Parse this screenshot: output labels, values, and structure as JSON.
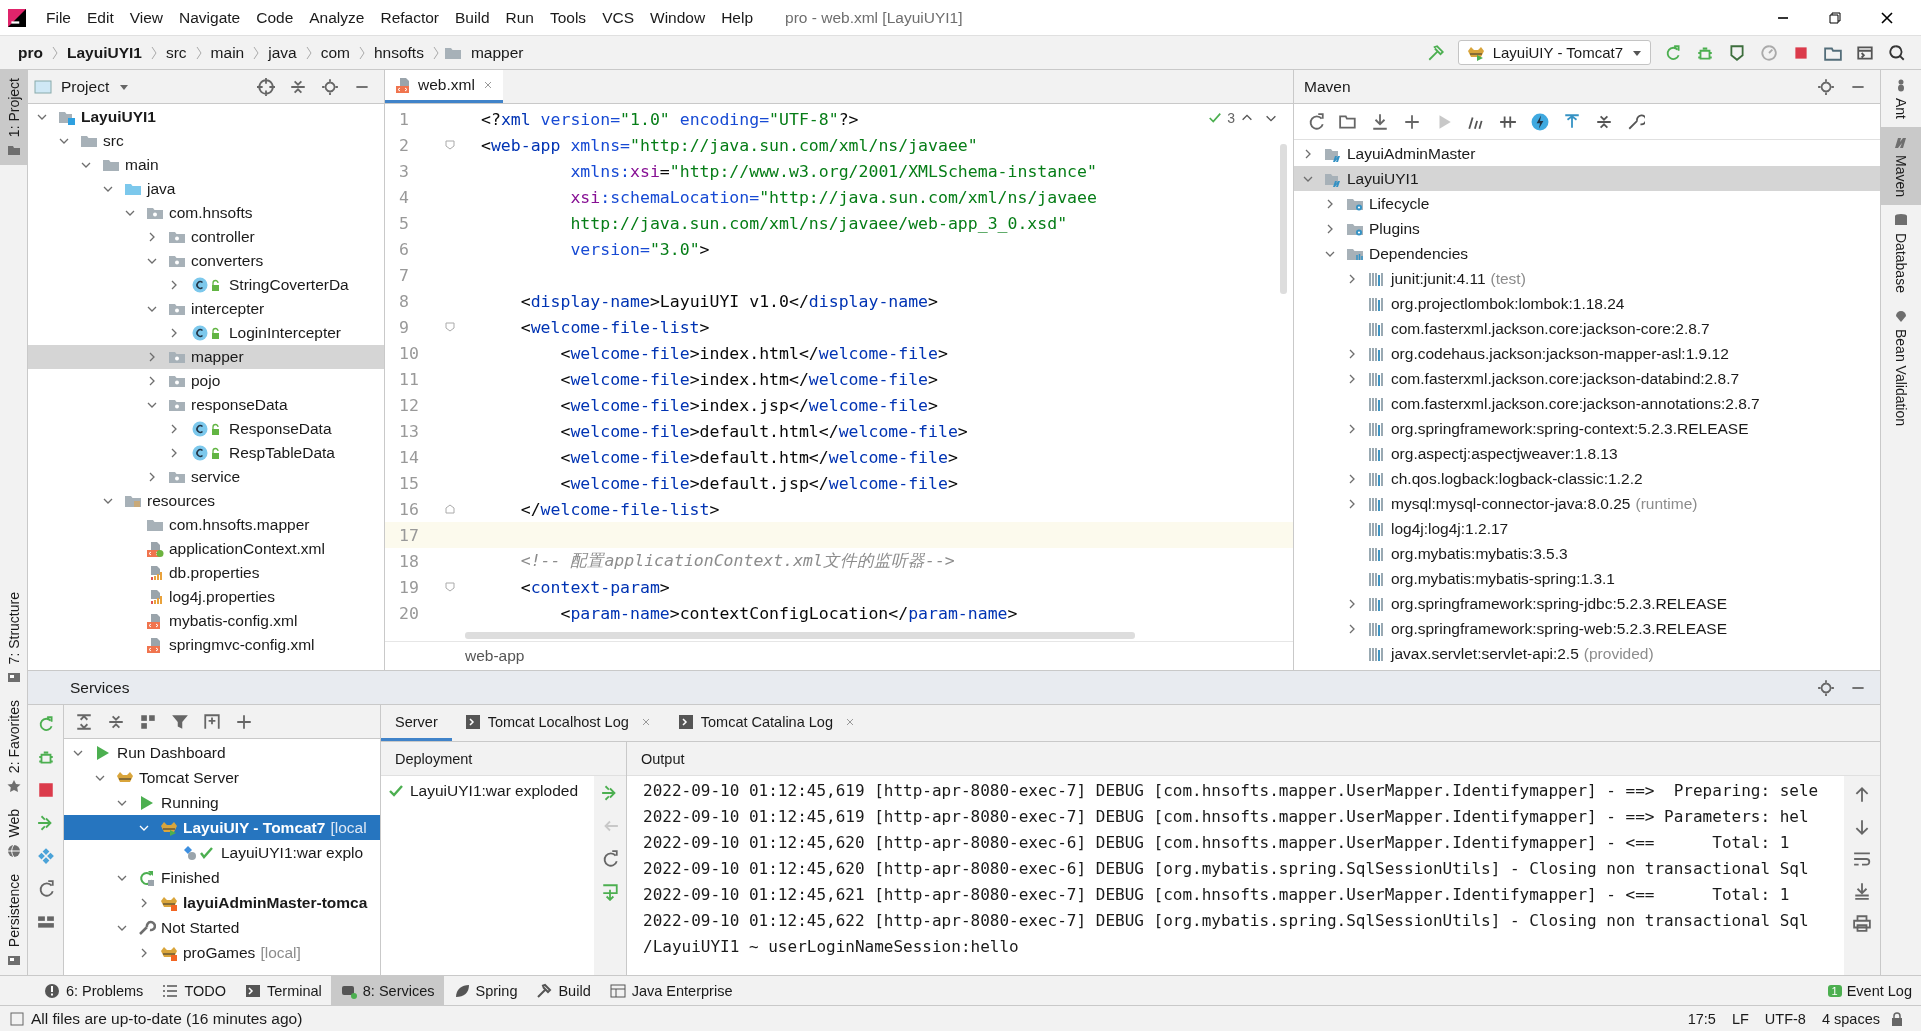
{
  "window": {
    "title": "pro - web.xml [LayuiUYI1]"
  },
  "menu": [
    "File",
    "Edit",
    "View",
    "Navigate",
    "Code",
    "Analyze",
    "Refactor",
    "Build",
    "Run",
    "Tools",
    "VCS",
    "Window",
    "Help"
  ],
  "breadcrumbs": [
    {
      "label": "pro",
      "bold": true
    },
    {
      "label": "LayuiUYI1",
      "bold": true
    },
    {
      "label": "src",
      "bold": false
    },
    {
      "label": "main",
      "bold": false
    },
    {
      "label": "java",
      "bold": false
    },
    {
      "label": "com",
      "bold": false
    },
    {
      "label": "hnsofts",
      "bold": false
    },
    {
      "label": "mapper",
      "bold": false,
      "kind": "folder"
    }
  ],
  "run_config": {
    "label": "LayuiUIY - Tomcat7"
  },
  "left_strip": [
    {
      "label": "1: Project",
      "kind": "folder",
      "selected": true
    },
    {
      "label": "7: Structure",
      "kind": "structure",
      "selected": false
    },
    {
      "label": "2: Favorites",
      "kind": "star",
      "selected": false
    },
    {
      "label": "Web",
      "kind": "globe",
      "selected": false
    },
    {
      "label": "Persistence",
      "kind": "persistence",
      "selected": false
    }
  ],
  "right_strip": [
    {
      "label": "Ant",
      "kind": "ant",
      "selected": false
    },
    {
      "label": "Maven",
      "kind": "maven",
      "selected": true
    },
    {
      "label": "Database",
      "kind": "database",
      "selected": false
    },
    {
      "label": "Bean Validation",
      "kind": "bean",
      "selected": false
    }
  ],
  "project": {
    "title": "Project",
    "tree": [
      {
        "label": "LayuiUYI1",
        "kind": "module",
        "bold": true,
        "expanded": true,
        "selected": false,
        "children": [
          {
            "label": "src",
            "kind": "folder",
            "expanded": true,
            "selected": false,
            "children": [
              {
                "label": "main",
                "kind": "folder",
                "expanded": true,
                "selected": false,
                "children": [
                  {
                    "label": "java",
                    "kind": "src-folder",
                    "expanded": true,
                    "selected": false,
                    "children": [
                      {
                        "label": "com.hnsofts",
                        "kind": "package",
                        "expanded": true,
                        "selected": false,
                        "children": [
                          {
                            "label": "controller",
                            "kind": "package",
                            "expanded": false,
                            "selected": false
                          },
                          {
                            "label": "converters",
                            "kind": "package",
                            "expanded": true,
                            "selected": false,
                            "children": [
                              {
                                "label": "StringCoverterDa",
                                "kind": "class",
                                "expanded": false,
                                "selected": false
                              }
                            ]
                          },
                          {
                            "label": "intercepter",
                            "kind": "package",
                            "expanded": true,
                            "selected": false,
                            "children": [
                              {
                                "label": "LoginIntercepter",
                                "kind": "class",
                                "expanded": false,
                                "selected": false
                              }
                            ]
                          },
                          {
                            "label": "mapper",
                            "kind": "package",
                            "expanded": false,
                            "selected": true
                          },
                          {
                            "label": "pojo",
                            "kind": "package",
                            "expanded": false,
                            "selected": false
                          },
                          {
                            "label": "responseData",
                            "kind": "package",
                            "expanded": true,
                            "selected": false,
                            "children": [
                              {
                                "label": "ResponseData",
                                "kind": "class",
                                "expanded": false,
                                "selected": false
                              },
                              {
                                "label": "RespTableData",
                                "kind": "class",
                                "expanded": false,
                                "selected": false
                              }
                            ]
                          },
                          {
                            "label": "service",
                            "kind": "package",
                            "expanded": false,
                            "selected": false
                          }
                        ]
                      }
                    ]
                  },
                  {
                    "label": "resources",
                    "kind": "resources-folder",
                    "expanded": true,
                    "selected": false,
                    "children": [
                      {
                        "label": "com.hnsofts.mapper",
                        "kind": "folder",
                        "selected": false
                      },
                      {
                        "label": "applicationContext.xml",
                        "kind": "spring-xml",
                        "selected": false
                      },
                      {
                        "label": "db.properties",
                        "kind": "properties",
                        "selected": false
                      },
                      {
                        "label": "log4j.properties",
                        "kind": "properties",
                        "selected": false
                      },
                      {
                        "label": "mybatis-config.xml",
                        "kind": "xml",
                        "selected": false
                      },
                      {
                        "label": "springmvc-config.xml",
                        "kind": "xml",
                        "selected": false
                      }
                    ]
                  }
                ]
              }
            ]
          }
        ]
      }
    ]
  },
  "editor": {
    "tabs": [
      {
        "label": "web.xml",
        "selected": true
      }
    ],
    "problems": "3",
    "breadcrumb": "web-app",
    "lines": [
      {
        "number": "1",
        "segments": [
          {
            "kind": "punct",
            "text": "<?"
          },
          {
            "kind": "tag",
            "text": "xml"
          },
          {
            "kind": "attr",
            "text": " version="
          },
          {
            "kind": "value",
            "text": "\"1.0\""
          },
          {
            "kind": "attr",
            "text": " encoding="
          },
          {
            "kind": "value",
            "text": "\"UTF-8\""
          },
          {
            "kind": "punct",
            "text": "?>"
          }
        ]
      },
      {
        "number": "2",
        "fold_start": true,
        "segments": [
          {
            "kind": "punct",
            "text": "<"
          },
          {
            "kind": "tag",
            "text": "web-app"
          },
          {
            "kind": "attr",
            "text": " xmlns="
          },
          {
            "kind": "value",
            "text": "\"http://java.sun.com/xml/ns/javaee\""
          }
        ]
      },
      {
        "number": "3",
        "segments": [
          {
            "kind": "attr",
            "text": "         xmlns:"
          },
          {
            "kind": "ns",
            "text": "xsi"
          },
          {
            "kind": "punct",
            "text": "="
          },
          {
            "kind": "value",
            "text": "\"http://www.w3.org/2001/XMLSchema-instance\""
          }
        ]
      },
      {
        "number": "4",
        "segments": [
          {
            "kind": "ns",
            "text": "         xsi"
          },
          {
            "kind": "attr",
            "text": ":schemaLocation="
          },
          {
            "kind": "value",
            "text": "\"http://java.sun.com/xml/ns/javaee"
          }
        ]
      },
      {
        "number": "5",
        "segments": [
          {
            "kind": "value",
            "text": "         http://java.sun.com/xml/ns/javaee/web-app_3_0.xsd\""
          }
        ]
      },
      {
        "number": "6",
        "segments": [
          {
            "kind": "attr",
            "text": "         version="
          },
          {
            "kind": "value",
            "text": "\"3.0\""
          },
          {
            "kind": "punct",
            "text": ">"
          }
        ]
      },
      {
        "number": "7"
      },
      {
        "number": "8",
        "segments": [
          {
            "kind": "punct",
            "text": "    <"
          },
          {
            "kind": "tag",
            "text": "display-name"
          },
          {
            "kind": "punct",
            "text": ">LayuiUYI v1.0</"
          },
          {
            "kind": "tag",
            "text": "display-name"
          },
          {
            "kind": "punct",
            "text": ">"
          }
        ]
      },
      {
        "number": "9",
        "fold_start": true,
        "segments": [
          {
            "kind": "punct",
            "text": "    <"
          },
          {
            "kind": "tag",
            "text": "welcome-file-list"
          },
          {
            "kind": "punct",
            "text": ">"
          }
        ]
      },
      {
        "number": "10",
        "segments": [
          {
            "kind": "punct",
            "text": "        <"
          },
          {
            "kind": "tag",
            "text": "welcome-file"
          },
          {
            "kind": "punct",
            "text": ">index.html</"
          },
          {
            "kind": "tag",
            "text": "welcome-file"
          },
          {
            "kind": "punct",
            "text": ">"
          }
        ]
      },
      {
        "number": "11",
        "segments": [
          {
            "kind": "punct",
            "text": "        <"
          },
          {
            "kind": "tag",
            "text": "welcome-file"
          },
          {
            "kind": "punct",
            "text": ">index.htm</"
          },
          {
            "kind": "tag",
            "text": "welcome-file"
          },
          {
            "kind": "punct",
            "text": ">"
          }
        ]
      },
      {
        "number": "12",
        "segments": [
          {
            "kind": "punct",
            "text": "        <"
          },
          {
            "kind": "tag",
            "text": "welcome-file"
          },
          {
            "kind": "punct",
            "text": ">index.jsp</"
          },
          {
            "kind": "tag",
            "text": "welcome-file"
          },
          {
            "kind": "punct",
            "text": ">"
          }
        ]
      },
      {
        "number": "13",
        "segments": [
          {
            "kind": "punct",
            "text": "        <"
          },
          {
            "kind": "tag",
            "text": "welcome-file"
          },
          {
            "kind": "punct",
            "text": ">default.html</"
          },
          {
            "kind": "tag",
            "text": "welcome-file"
          },
          {
            "kind": "punct",
            "text": ">"
          }
        ]
      },
      {
        "number": "14",
        "segments": [
          {
            "kind": "punct",
            "text": "        <"
          },
          {
            "kind": "tag",
            "text": "welcome-file"
          },
          {
            "kind": "punct",
            "text": ">default.htm</"
          },
          {
            "kind": "tag",
            "text": "welcome-file"
          },
          {
            "kind": "punct",
            "text": ">"
          }
        ]
      },
      {
        "number": "15",
        "segments": [
          {
            "kind": "punct",
            "text": "        <"
          },
          {
            "kind": "tag",
            "text": "welcome-file"
          },
          {
            "kind": "punct",
            "text": ">default.jsp</"
          },
          {
            "kind": "tag",
            "text": "welcome-file"
          },
          {
            "kind": "punct",
            "text": ">"
          }
        ]
      },
      {
        "number": "16",
        "fold_end": true,
        "segments": [
          {
            "kind": "punct",
            "text": "    </"
          },
          {
            "kind": "tag",
            "text": "welcome-file-list"
          },
          {
            "kind": "punct",
            "text": ">"
          }
        ]
      },
      {
        "number": "17",
        "current": true
      },
      {
        "number": "18",
        "segments": [
          {
            "kind": "comment",
            "text": "    <!-- 配置applicationContext.xml文件的监听器-->"
          }
        ]
      },
      {
        "number": "19",
        "fold_start": true,
        "segments": [
          {
            "kind": "punct",
            "text": "    <"
          },
          {
            "kind": "tag",
            "text": "context-param"
          },
          {
            "kind": "punct",
            "text": ">"
          }
        ]
      },
      {
        "number": "20",
        "segments": [
          {
            "kind": "punct",
            "text": "        <"
          },
          {
            "kind": "tag",
            "text": "param-name"
          },
          {
            "kind": "punct",
            "text": ">contextConfigLocation</"
          },
          {
            "kind": "tag",
            "text": "param-name"
          },
          {
            "kind": "punct",
            "text": ">"
          }
        ]
      }
    ]
  },
  "maven": {
    "title": "Maven",
    "tree": [
      {
        "label": "LayuiAdminMaster",
        "kind": "maven-module",
        "expanded": false,
        "selected": false
      },
      {
        "label": "LayuiUYI1",
        "kind": "maven-module",
        "expanded": true,
        "selected": true,
        "children": [
          {
            "label": "Lifecycle",
            "kind": "gear-folder",
            "expanded": false,
            "selected": false
          },
          {
            "label": "Plugins",
            "kind": "gear-folder",
            "expanded": false,
            "selected": false
          },
          {
            "label": "Dependencies",
            "kind": "deps-folder",
            "expanded": true,
            "selected": false,
            "children": [
              {
                "label": "junit:junit:4.11",
                "suffix": "(test)",
                "kind": "library",
                "expanded": false,
                "selected": false
              },
              {
                "label": "org.projectlombok:lombok:1.18.24",
                "kind": "library",
                "selected": false
              },
              {
                "label": "com.fasterxml.jackson.core:jackson-core:2.8.7",
                "kind": "library",
                "selected": false
              },
              {
                "label": "org.codehaus.jackson:jackson-mapper-asl:1.9.12",
                "kind": "library",
                "expanded": false,
                "selected": false
              },
              {
                "label": "com.fasterxml.jackson.core:jackson-databind:2.8.7",
                "kind": "library",
                "expanded": false,
                "selected": false
              },
              {
                "label": "com.fasterxml.jackson.core:jackson-annotations:2.8.7",
                "kind": "library",
                "selected": false
              },
              {
                "label": "org.springframework:spring-context:5.2.3.RELEASE",
                "kind": "library",
                "expanded": false,
                "selected": false
              },
              {
                "label": "org.aspectj:aspectjweaver:1.8.13",
                "kind": "library",
                "selected": false
              },
              {
                "label": "ch.qos.logback:logback-classic:1.2.2",
                "kind": "library",
                "expanded": false,
                "selected": false
              },
              {
                "label": "mysql:mysql-connector-java:8.0.25",
                "suffix": "(runtime)",
                "kind": "library",
                "expanded": false,
                "selected": false
              },
              {
                "label": "log4j:log4j:1.2.17",
                "kind": "library",
                "selected": false
              },
              {
                "label": "org.mybatis:mybatis:3.5.3",
                "kind": "library",
                "selected": false
              },
              {
                "label": "org.mybatis:mybatis-spring:1.3.1",
                "kind": "library",
                "selected": false
              },
              {
                "label": "org.springframework:spring-jdbc:5.2.3.RELEASE",
                "kind": "library",
                "expanded": false,
                "selected": false
              },
              {
                "label": "org.springframework:spring-web:5.2.3.RELEASE",
                "kind": "library",
                "expanded": false,
                "selected": false
              },
              {
                "label": "javax.servlet:servlet-api:2.5",
                "suffix": "(provided)",
                "kind": "library",
                "selected": false
              }
            ]
          }
        ]
      }
    ]
  },
  "services": {
    "title": "Services",
    "tree": [
      {
        "label": "Run Dashboard",
        "kind": "run",
        "expanded": true,
        "selected": false,
        "children": [
          {
            "label": "Tomcat Server",
            "kind": "tomcat",
            "expanded": true,
            "selected": false,
            "children": [
              {
                "label": "Running",
                "kind": "run",
                "expanded": true,
                "selected": false,
                "children": [
                  {
                    "label": "LayuiUIY - Tomcat7",
                    "suffix": "[local",
                    "kind": "tomcat-running",
                    "bold": true,
                    "expanded": true,
                    "selected": true,
                    "children": [
                      {
                        "label": "LayuiUYI1:war explo",
                        "kind": "artifact",
                        "selected": false
                      }
                    ]
                  }
                ]
              },
              {
                "label": "Finished",
                "kind": "finished",
                "expanded": true,
                "selected": false,
                "children": [
                  {
                    "label": "layuiAdminMaster-tomca",
                    "kind": "tomcat-stopped",
                    "bold": true,
                    "expanded": false,
                    "selected": false
                  }
                ]
              },
              {
                "label": "Not Started",
                "kind": "wrench",
                "expanded": true,
                "selected": false,
                "children": [
                  {
                    "label": "proGames",
                    "suffix": "[local]",
                    "kind": "tomcat-stopped",
                    "expanded": false,
                    "selected": false
                  }
                ]
              }
            ]
          }
        ]
      }
    ],
    "tabs": [
      {
        "label": "Server",
        "selected": true,
        "closable": false
      },
      {
        "label": "Tomcat Localhost Log",
        "selected": false,
        "closable": true
      },
      {
        "label": "Tomcat Catalina Log",
        "selected": false,
        "closable": true
      }
    ],
    "deployment": {
      "title": "Deployment",
      "items": [
        "LayuiUYI1:war exploded"
      ]
    },
    "output": {
      "title": "Output",
      "lines": [
        "2022-09-10 01:12:45,619 [http-apr-8080-exec-7] DEBUG [com.hnsofts.mapper.UserMapper.Identifymapper] - ==>  Preparing: sele",
        "2022-09-10 01:12:45,619 [http-apr-8080-exec-7] DEBUG [com.hnsofts.mapper.UserMapper.Identifymapper] - ==> Parameters: hel",
        "2022-09-10 01:12:45,620 [http-apr-8080-exec-6] DEBUG [com.hnsofts.mapper.UserMapper.Identifymapper] - <==      Total: 1",
        "2022-09-10 01:12:45,620 [http-apr-8080-exec-6] DEBUG [org.mybatis.spring.SqlSessionUtils] - Closing non transactional Sql",
        "2022-09-10 01:12:45,621 [http-apr-8080-exec-7] DEBUG [com.hnsofts.mapper.UserMapper.Identifymapper] - <==      Total: 1",
        "2022-09-10 01:12:45,622 [http-apr-8080-exec-7] DEBUG [org.mybatis.spring.SqlSessionUtils] - Closing non transactional Sql",
        "/LayuiUYI1 ~ userLoginNameSession:hello"
      ]
    }
  },
  "bottom_tabs": [
    {
      "label": "6: Problems",
      "kind": "problems",
      "selected": false
    },
    {
      "label": "TODO",
      "kind": "todo",
      "selected": false
    },
    {
      "label": "Terminal",
      "kind": "terminal",
      "selected": false
    },
    {
      "label": "8: Services",
      "kind": "services",
      "selected": true
    },
    {
      "label": "Spring",
      "kind": "spring",
      "selected": false
    },
    {
      "label": "Build",
      "kind": "build",
      "selected": false
    },
    {
      "label": "Java Enterprise",
      "kind": "enterprise",
      "selected": false
    }
  ],
  "event_log": {
    "label": "Event Log",
    "count": "1"
  },
  "status_bar": {
    "message": "All files are up-to-date (16 minutes ago)",
    "items": [
      "17:5",
      "LF",
      "UTF-8",
      "4 spaces"
    ]
  }
}
